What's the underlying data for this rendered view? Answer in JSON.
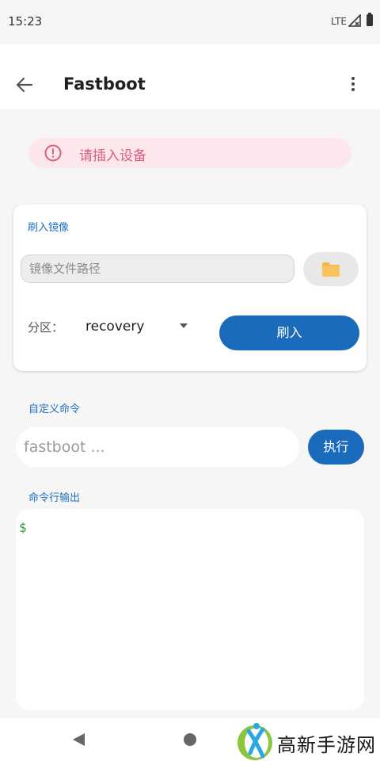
{
  "status_bar": {
    "time": "15:23",
    "network": "LTE"
  },
  "app_bar": {
    "title": "Fastboot",
    "back_icon": "arrow-left-icon",
    "menu_icon": "more-vert-icon"
  },
  "banner": {
    "icon": "error-circle-icon",
    "message": "请插入设备",
    "color": "#e05a7a",
    "background": "#fce8ec"
  },
  "flash_card": {
    "section_label": "刷入镜像",
    "image_path": {
      "value": "",
      "placeholder": "镜像文件路径"
    },
    "folder_icon": "folder-icon",
    "partition_label": "分区：",
    "partition_value": "recovery",
    "flash_button": "刷入"
  },
  "custom_command": {
    "section_label": "自定义命令",
    "input_placeholder": "fastboot ...",
    "execute_button": "执行"
  },
  "output": {
    "section_label": "命令行输出",
    "prompt": "$"
  },
  "nav_bar": {
    "back_icon": "triangle-back-icon",
    "home_icon": "circle-home-icon"
  },
  "watermark": {
    "text": "高新手游网"
  },
  "colors": {
    "accent": "#1b6bbd",
    "label_blue": "#1e6fc4",
    "prompt_green": "#3a9a3a"
  }
}
